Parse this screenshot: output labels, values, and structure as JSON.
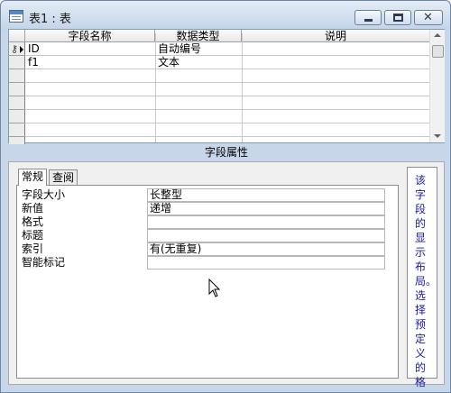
{
  "window": {
    "title": "表1 : 表",
    "buttons": {
      "minimize": "minimize",
      "maximize": "maximize",
      "close": "✕"
    }
  },
  "grid": {
    "columns": [
      "字段名称",
      "数据类型",
      "说明"
    ],
    "rows": [
      {
        "name": "ID",
        "type": "自动编号",
        "description": "",
        "is_primary_key": true,
        "is_current": true
      },
      {
        "name": "f1",
        "type": "文本",
        "description": "",
        "is_primary_key": false,
        "is_current": false
      }
    ]
  },
  "properties_band": "字段属性",
  "tabs": [
    {
      "label": "常规",
      "active": true
    },
    {
      "label": "查阅",
      "active": false
    }
  ],
  "properties": [
    {
      "label": "字段大小",
      "value": "长整型"
    },
    {
      "label": "新值",
      "value": "递增"
    },
    {
      "label": "格式",
      "value": ""
    },
    {
      "label": "标题",
      "value": ""
    },
    {
      "label": "索引",
      "value": "有(无重复)"
    },
    {
      "label": "智能标记",
      "value": ""
    }
  ],
  "help_text": "该字段的显示布局。选择预定义的格",
  "colors": {
    "help_text": "#1a1aa0",
    "titlebar": "#c4d4e8"
  }
}
